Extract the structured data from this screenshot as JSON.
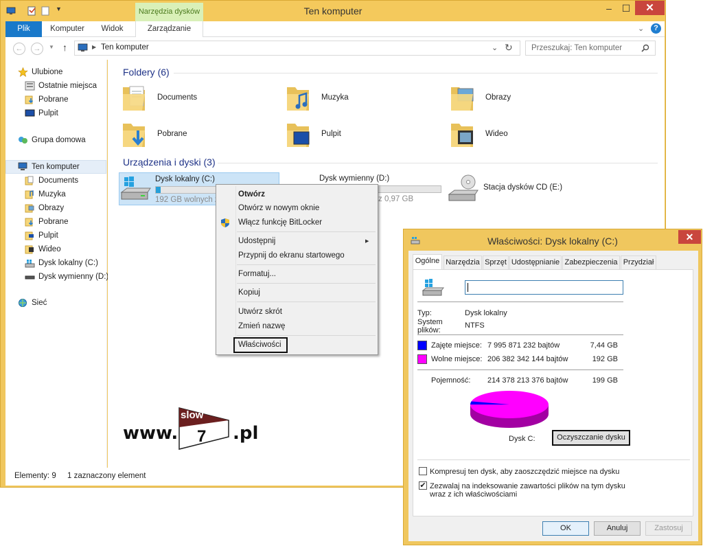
{
  "window": {
    "title": "Ten komputer",
    "context_tab": "Narzędzia dysków",
    "buttons": {
      "minimize": "–",
      "maximize": "☐",
      "close": "✕"
    }
  },
  "ribbon": {
    "tabs": [
      "Plik",
      "Komputer",
      "Widok",
      "Zarządzanie"
    ]
  },
  "address": {
    "breadcrumb": "Ten komputer",
    "search_placeholder": "Przeszukaj: Ten komputer"
  },
  "nav": {
    "favorites_label": "Ulubione",
    "favorites": [
      "Ostatnie miejsca",
      "Pobrane",
      "Pulpit"
    ],
    "homegroup": "Grupa domowa",
    "computer_label": "Ten komputer",
    "computer_items": [
      "Documents",
      "Muzyka",
      "Obrazy",
      "Pobrane",
      "Pulpit",
      "Wideo",
      "Dysk lokalny (C:)",
      "Dysk wymienny (D:)"
    ],
    "network": "Sieć"
  },
  "content": {
    "folders_header": "Foldery (6)",
    "folders": [
      "Documents",
      "Muzyka",
      "Obrazy",
      "Pobrane",
      "Pulpit",
      "Wideo"
    ],
    "devices_header": "Urządzenia i dyski (3)",
    "drives": [
      {
        "name": "Dysk lokalny (C:)",
        "free": "192 GB wolnych z",
        "used_fraction": 0.04
      },
      {
        "name": "Dysk wymienny (D:)",
        "free": "z 0,97 GB",
        "used_fraction": 0.0
      },
      {
        "name": "Stacja dysków CD (E:)"
      }
    ]
  },
  "watermark": {
    "left": "www.",
    "badge_top": "slow",
    "badge_num": "7",
    "right": ".pl"
  },
  "status": {
    "items": "Elementy: 9",
    "selected": "1 zaznaczony element"
  },
  "context_menu": {
    "items": [
      "Otwórz",
      "Otwórz w nowym oknie",
      "Włącz funkcję BitLocker",
      "Udostępnij",
      "Przypnij do ekranu startowego",
      "Formatuj...",
      "Kopiuj",
      "Utwórz skrót",
      "Zmień nazwę",
      "Właściwości"
    ],
    "submenu_arrow": "▶"
  },
  "properties": {
    "title": "Właściwości: Dysk lokalny (C:)",
    "tabs": [
      "Ogólne",
      "Narzędzia",
      "Sprzęt",
      "Udostępnianie",
      "Zabezpieczenia",
      "Przydział"
    ],
    "name_value": "",
    "type_label": "Typ:",
    "type_value": "Dysk lokalny",
    "fs_label": "System plików:",
    "fs_value": "NTFS",
    "used_label": "Zajęte miejsce:",
    "used_bytes": "7 995 871 232 bajtów",
    "used_gb": "7,44 GB",
    "free_label": "Wolne miejsce:",
    "free_bytes": "206 382 342 144 bajtów",
    "free_gb": "192 GB",
    "capacity_label": "Pojemność:",
    "capacity_bytes": "214 378 213 376 bajtów",
    "capacity_gb": "199 GB",
    "disk_label": "Dysk C:",
    "cleanup_button": "Oczyszczanie dysku",
    "compress_label": "Kompresuj ten dysk, aby zaoszczędzić miejsce na dysku",
    "compress_checked": false,
    "index_label_1": "Zezwalaj na indeksowanie zawartości plików na tym dysku",
    "index_label_2": "wraz z ich właściwościami",
    "index_checked": true,
    "check_mark": "✔",
    "ok": "OK",
    "cancel": "Anuluj",
    "apply": "Zastosuj",
    "used_color": "#0000ff",
    "free_color": "#ff00ff"
  }
}
